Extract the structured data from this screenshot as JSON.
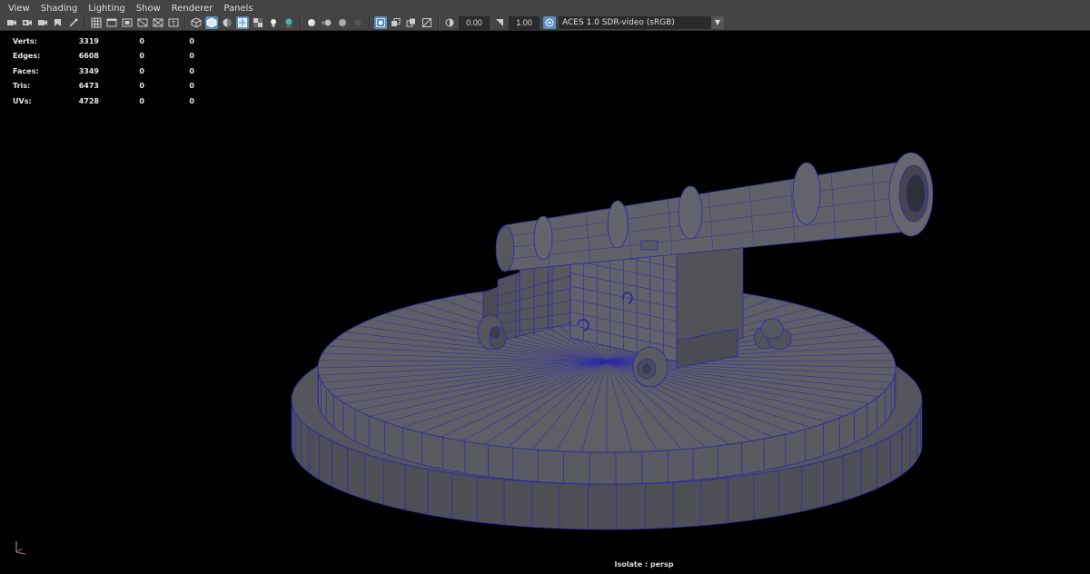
{
  "menu": [
    "View",
    "Shading",
    "Lighting",
    "Show",
    "Renderer",
    "Panels"
  ],
  "toolbar": {
    "exposure": "0.00",
    "gamma": "1.00",
    "color_space": "ACES 1.0 SDR-video (sRGB)"
  },
  "hud": {
    "rows": [
      {
        "label": "Verts:",
        "v1": "3319",
        "v2": "0",
        "v3": "0"
      },
      {
        "label": "Edges:",
        "v1": "6608",
        "v2": "0",
        "v3": "0"
      },
      {
        "label": "Faces:",
        "v1": "3349",
        "v2": "0",
        "v3": "0"
      },
      {
        "label": "Tris:",
        "v1": "6473",
        "v2": "0",
        "v3": "0"
      },
      {
        "label": "UVs:",
        "v1": "4728",
        "v2": "0",
        "v3": "0"
      }
    ]
  },
  "camera_label": "Isolate : persp",
  "colors": {
    "accent": "#5a8fbf",
    "wire": "#2a2aa8",
    "mesh": "#5e5e66"
  }
}
